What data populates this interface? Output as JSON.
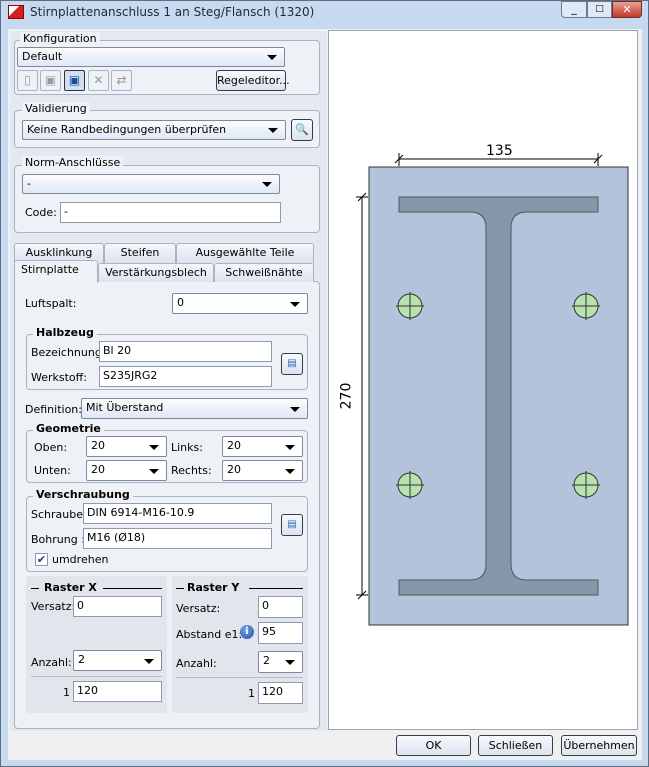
{
  "window": {
    "title": "Stirnplattenanschluss 1 an Steg/Flansch (1320)"
  },
  "konfiguration": {
    "label": "Konfiguration",
    "selected": "Default",
    "regeleditor": "Regeleditor..."
  },
  "validierung": {
    "label": "Validierung",
    "selected": "Keine Randbedingungen überprüfen"
  },
  "norm": {
    "label": "Norm-Anschlüsse",
    "selected": "-",
    "code_label": "Code:",
    "code_value": "-"
  },
  "tabs": {
    "row1": [
      "Ausklinkung",
      "Steifen",
      "Ausgewählte Teile"
    ],
    "row2": [
      "Stirnplatte",
      "Verstärkungsblech",
      "Schweißnähte"
    ],
    "active": "Stirnplatte"
  },
  "stirnplatte": {
    "luftspalt_label": "Luftspalt:",
    "luftspalt": "0",
    "halbzeug": {
      "label": "Halbzeug",
      "bez_label": "Bezeichnung:",
      "bez": "Bl 20",
      "werk_label": "Werkstoff:",
      "werk": "S235JRG2"
    },
    "definition_label": "Definition:",
    "definition": "Mit Überstand",
    "geometrie": {
      "label": "Geometrie",
      "oben_label": "Oben:",
      "oben": "20",
      "unten_label": "Unten:",
      "unten": "20",
      "links_label": "Links:",
      "links": "20",
      "rechts_label": "Rechts:",
      "rechts": "20"
    },
    "verschraubung": {
      "label": "Verschraubung",
      "schraube_label": "Schraube:",
      "schraube": "DIN 6914-M16-10.9",
      "bohrung_label": "Bohrung :",
      "bohrung": "M16 (Ø18)",
      "umdrehen": "umdrehen",
      "umdrehen_checked": true
    },
    "raster_x": {
      "label": "Raster X",
      "versatz_label": "Versatz:",
      "versatz": "0",
      "anzahl_label": "Anzahl:",
      "anzahl": "2",
      "row_index": "1",
      "row_value": "120"
    },
    "raster_y": {
      "label": "Raster Y",
      "versatz_label": "Versatz:",
      "versatz": "0",
      "abstand_label": "Abstand e1:",
      "abstand": "95",
      "anzahl_label": "Anzahl:",
      "anzahl": "2",
      "row_index": "1",
      "row_value": "120"
    }
  },
  "drawing": {
    "dim_width": "135",
    "dim_height": "270"
  },
  "footer": {
    "ok": "OK",
    "close": "Schließen",
    "apply": "Übernehmen"
  }
}
